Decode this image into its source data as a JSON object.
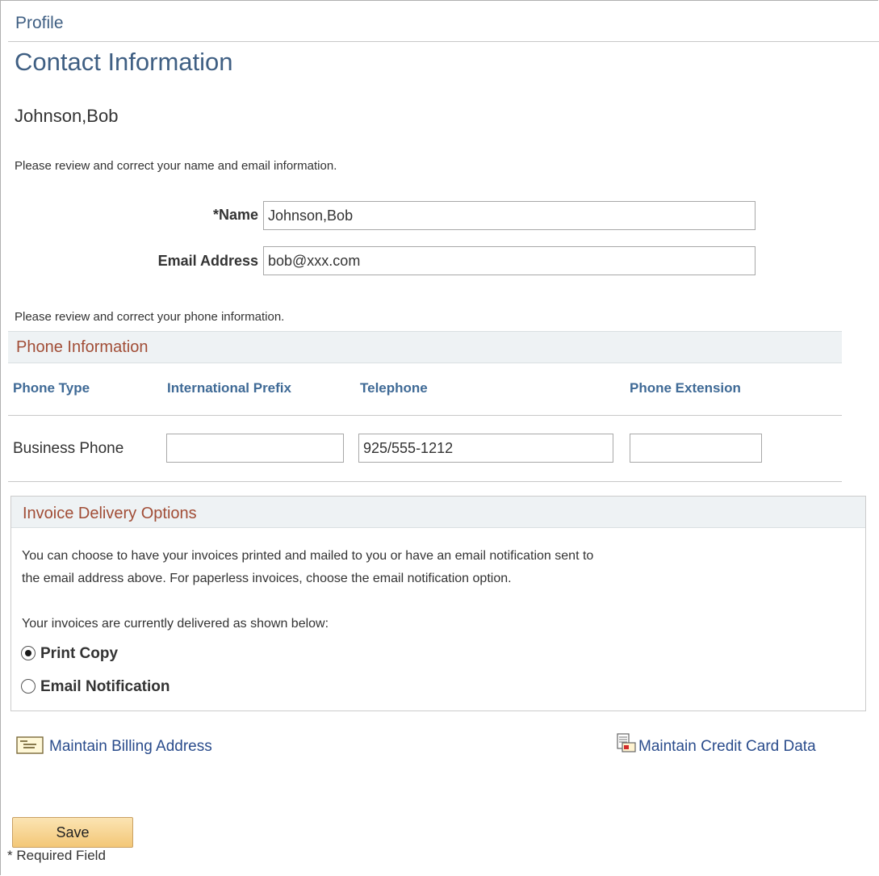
{
  "header": {
    "breadcrumb": "Profile",
    "title": "Contact Information",
    "person_name": "Johnson,Bob"
  },
  "name_section": {
    "instruction": "Please review and correct your name and email information.",
    "name_label": "*Name",
    "name_value": "Johnson,Bob",
    "email_label": "Email Address",
    "email_value": "bob@xxx.com"
  },
  "phone_section": {
    "instruction": "Please review and correct your phone information.",
    "title": "Phone Information",
    "columns": [
      "Phone Type",
      "International Prefix",
      "Telephone",
      "Phone Extension"
    ],
    "rows": [
      {
        "phone_type": "Business Phone",
        "international_prefix": "",
        "telephone": "925/555-1212",
        "extension": ""
      }
    ]
  },
  "invoice_section": {
    "title": "Invoice Delivery Options",
    "description_line1": "You can choose to have your invoices printed and mailed to you or have an email notification sent to",
    "description_line2": "the email address above. For paperless invoices, choose the email notification option.",
    "current_text": "Your invoices are currently delivered as shown below:",
    "options": [
      {
        "label": "Print Copy",
        "selected": true
      },
      {
        "label": "Email Notification",
        "selected": false
      }
    ]
  },
  "links": {
    "billing_address": "Maintain Billing Address",
    "credit_card": "Maintain Credit Card Data"
  },
  "actions": {
    "save_label": "Save"
  },
  "footer": {
    "required_note": "* Required Field"
  },
  "colors": {
    "title_blue": "#3f5f83",
    "section_title_rust": "#a14d36",
    "column_header_blue": "#3f6a96",
    "link_blue": "#2a4c8c",
    "button_gold": "#f3c777"
  },
  "icons": {
    "billing": "envelope-address-icon",
    "credit_card": "credit-card-document-icon",
    "radio_selected": "radio-checked-icon",
    "radio_unselected": "radio-unchecked-icon"
  }
}
